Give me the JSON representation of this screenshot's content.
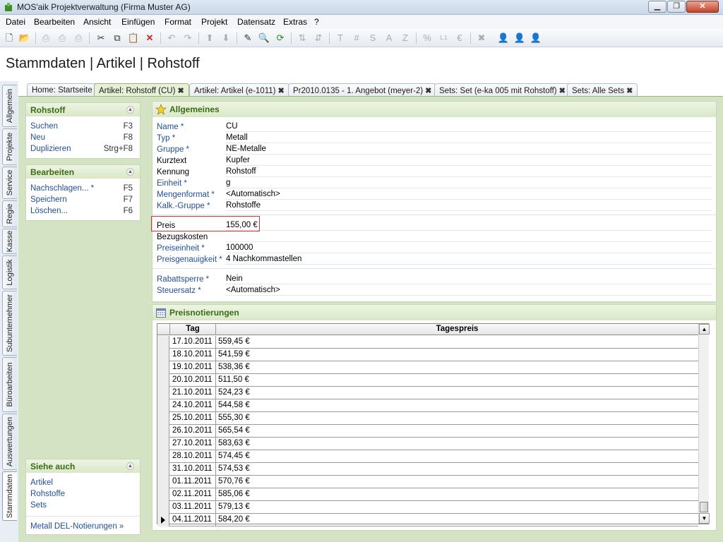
{
  "window": {
    "title": "MOS'aik Projektverwaltung (Firma Muster AG)"
  },
  "menu": [
    "Datei",
    "Bearbeiten",
    "Ansicht",
    "Einfügen",
    "Format",
    "Projekt",
    "Datensatz",
    "Extras",
    "?"
  ],
  "toolbar_icons": [
    "new-document",
    "open",
    "print",
    "print-preview",
    "print-setup",
    "cut",
    "copy",
    "paste",
    "delete",
    "undo",
    "redo",
    "move-up",
    "move-down",
    "edit",
    "search",
    "refresh",
    "sort-ascending",
    "sort-descending",
    "T",
    "#",
    "S",
    "A",
    "Z",
    "%",
    "1.1",
    "€$",
    "user-x",
    "user-blue",
    "user-yellow",
    "user-red"
  ],
  "page": {
    "title": "Stammdaten | Artikel | Rohstoff"
  },
  "vertical_tabs": [
    "Allgemein",
    "Projekte",
    "Service",
    "Regie",
    "Kasse",
    "Logistik",
    "Subunternehmer",
    "Büroarbeiten",
    "Auswertungen",
    "Stammdaten"
  ],
  "doc_tabs": [
    {
      "label": "Home: Startseite",
      "closable": false
    },
    {
      "label": "Artikel: Rohstoff (CU)",
      "closable": true,
      "active": true
    },
    {
      "label": "Artikel: Artikel (e-1011)",
      "closable": true
    },
    {
      "label": "Pr2010.0135 - 1. Angebot (meyer-2)",
      "closable": true
    },
    {
      "label": "Sets: Set (e-ka 005 mit Rohstoff)",
      "closable": true
    },
    {
      "label": "Sets: Alle Sets",
      "closable": true
    }
  ],
  "close_glyph": "✖",
  "sidebar": {
    "rohstoff": {
      "title": "Rohstoff",
      "items": [
        {
          "label": "Suchen",
          "key": "F3"
        },
        {
          "label": "Neu",
          "key": "F8"
        },
        {
          "label": "Duplizieren",
          "key": "Strg+F8"
        }
      ]
    },
    "bearbeiten": {
      "title": "Bearbeiten",
      "items": [
        {
          "label": "Nachschlagen... *",
          "key": "F5"
        },
        {
          "label": "Speichern",
          "key": "F7"
        },
        {
          "label": "Löschen...",
          "key": "F6"
        }
      ]
    },
    "siehe_auch": {
      "title": "Siehe auch",
      "items": [
        "Artikel",
        "Rohstoffe",
        "Sets"
      ],
      "footer": "Metall DEL-Notierungen »"
    }
  },
  "allgemeines": {
    "title": "Allgemeines",
    "group1": [
      {
        "label": "Name *",
        "value": "CU",
        "link": true
      },
      {
        "label": "Typ *",
        "value": "Metall",
        "link": true
      },
      {
        "label": "Gruppe *",
        "value": "NE-Metalle",
        "link": true
      },
      {
        "label": "Kurztext",
        "value": "Kupfer",
        "link": false
      },
      {
        "label": "Kennung",
        "value": "Rohstoff",
        "link": false
      },
      {
        "label": "Einheit *",
        "value": "g",
        "link": true
      },
      {
        "label": "Mengenformat *",
        "value": "<Automatisch>",
        "link": true
      },
      {
        "label": "Kalk.-Gruppe *",
        "value": "Rohstoffe",
        "link": true
      }
    ],
    "group2": [
      {
        "label": "Preis",
        "value": "155,00 €",
        "link": false
      },
      {
        "label": "Bezugskosten",
        "value": "",
        "link": false
      },
      {
        "label": "Preiseinheit *",
        "value": "100000",
        "link": true
      },
      {
        "label": "Preisgenauigkeit *",
        "value": "4 Nachkommastellen",
        "link": true
      }
    ],
    "group3": [
      {
        "label": "Rabattsperre *",
        "value": "Nein",
        "link": true
      },
      {
        "label": "Steuersatz *",
        "value": "<Automatisch>",
        "link": true
      }
    ]
  },
  "preisnotierungen": {
    "title": "Preisnotierungen",
    "columns": [
      "Tag",
      "Tagespreis"
    ],
    "rows": [
      [
        "17.10.2011",
        "559,45 €"
      ],
      [
        "18.10.2011",
        "541,59 €"
      ],
      [
        "19.10.2011",
        "538,36 €"
      ],
      [
        "20.10.2011",
        "511,50 €"
      ],
      [
        "21.10.2011",
        "524,23 €"
      ],
      [
        "24.10.2011",
        "544,58 €"
      ],
      [
        "25.10.2011",
        "555,30 €"
      ],
      [
        "26.10.2011",
        "565,54 €"
      ],
      [
        "27.10.2011",
        "583,63 €"
      ],
      [
        "28.10.2011",
        "574,45 €"
      ],
      [
        "31.10.2011",
        "574,53 €"
      ],
      [
        "01.11.2011",
        "570,76 €"
      ],
      [
        "02.11.2011",
        "585,06 €"
      ],
      [
        "03.11.2011",
        "579,13 €"
      ],
      [
        "04.11.2011",
        "584,20 €"
      ]
    ],
    "current_row_index": 14
  }
}
